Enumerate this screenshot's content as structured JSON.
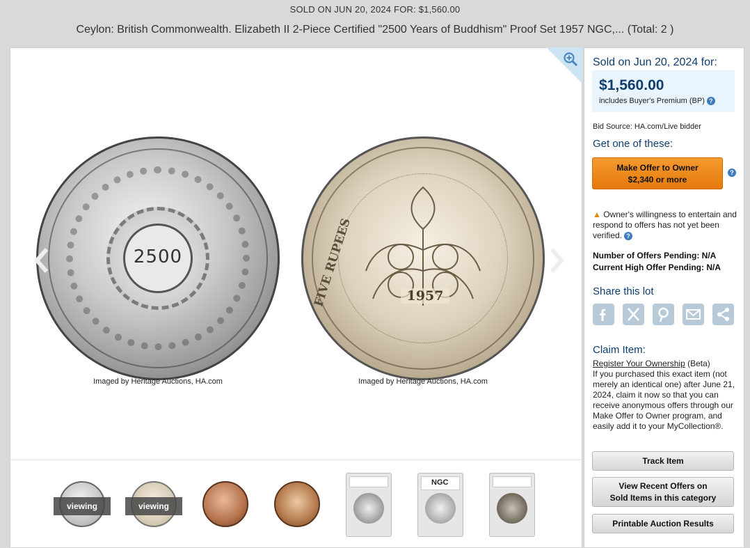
{
  "header": {
    "sold_line": "SOLD ON JUN 20, 2024 FOR: $1,560.00",
    "title": "Ceylon: British Commonwealth. Elizabeth II 2-Piece Certified \"2500 Years of Buddhism\" Proof Set 1957 NGC,... (Total: 2 )"
  },
  "viewer": {
    "left_coin_text": "2500",
    "right_coin_year": "1957",
    "right_coin_text": "FIVE RUPEES",
    "captions": [
      "Imaged by Heritage Auctions, HA.com",
      "Imaged by Heritage Auctions, HA.com"
    ],
    "icons": {
      "zoom": "zoom-in-icon",
      "prev": "chevron-left-icon",
      "next": "chevron-right-icon"
    }
  },
  "thumbnails": [
    {
      "kind": "coin-silver",
      "badge": "viewing"
    },
    {
      "kind": "coin-silver",
      "badge": "viewing"
    },
    {
      "kind": "coin-copper",
      "badge": ""
    },
    {
      "kind": "coin-copper",
      "badge": ""
    },
    {
      "kind": "slab",
      "badge": ""
    },
    {
      "kind": "slab-ngc",
      "badge": "",
      "logo": "NGC"
    },
    {
      "kind": "slab",
      "badge": ""
    }
  ],
  "sidebar": {
    "sold_on": "Sold on Jun 20, 2024 for:",
    "price": "$1,560.00",
    "bp_note": "includes Buyer's Premium (BP)",
    "bid_source": "Bid Source: HA.com/Live bidder",
    "get_one": "Get one of these:",
    "offer_button_line1": "Make Offer to Owner",
    "offer_button_line2": "$2,340 or more",
    "warning": "Owner's willingness to entertain and respond to offers has not yet been verified.",
    "offers_pending": "Number of Offers Pending: N/A",
    "high_offer": "Current High Offer Pending: N/A",
    "share_label": "Share this lot",
    "share_icons": [
      "facebook-icon",
      "x-icon",
      "pinterest-icon",
      "email-icon",
      "share-icon"
    ],
    "claim_label": "Claim Item:",
    "register_link": "Register Your Ownership",
    "beta": " (Beta)",
    "claim_text": "If you purchased this exact item (not merely an identical one) after June 21, 2024, claim it now so that you can receive anonymous offers through our Make Offer to Owner program, and easily add it to your MyCollection®.",
    "track_button": "Track Item",
    "recent_offers_line1": "View Recent Offers on",
    "recent_offers_line2": "Sold Items in this category",
    "printable_button": "Printable Auction Results"
  },
  "colors": {
    "accent": "#0e3e6e",
    "offer_button": "#f08a1c",
    "price_box": "#eaf4fc"
  }
}
